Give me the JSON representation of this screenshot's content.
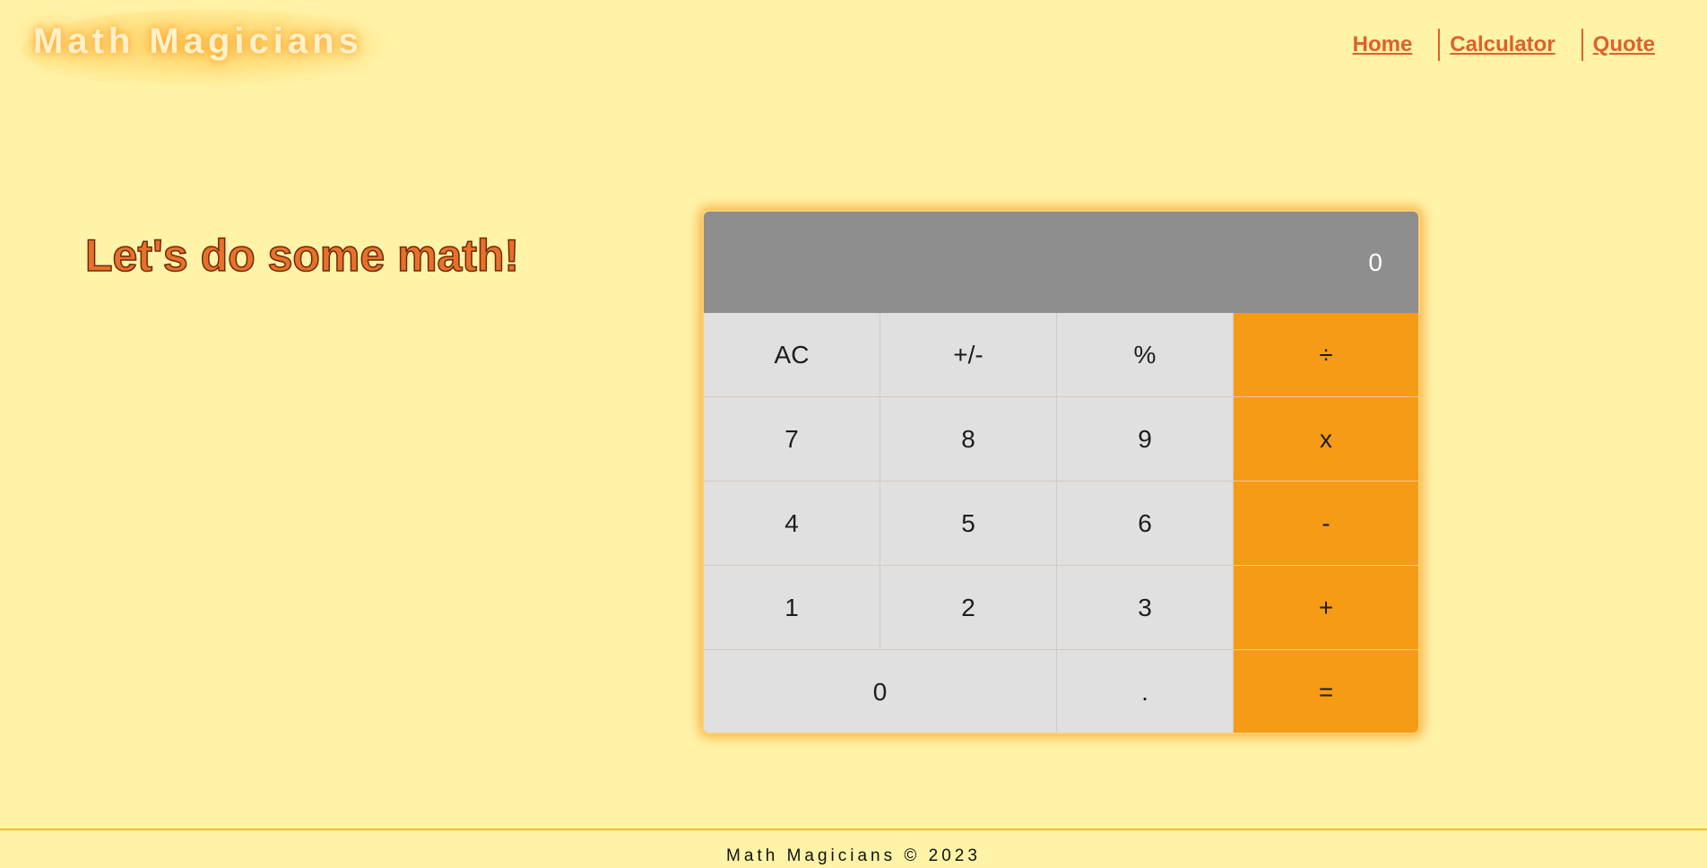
{
  "header": {
    "logo": "Math Magicians",
    "nav": [
      {
        "label": "Home"
      },
      {
        "label": "Calculator"
      },
      {
        "label": "Quote"
      }
    ]
  },
  "main": {
    "heading": "Let's do some math!"
  },
  "calculator": {
    "display": "0",
    "keys": [
      "AC",
      "+/-",
      "%",
      "÷",
      "7",
      "8",
      "9",
      "x",
      "4",
      "5",
      "6",
      "-",
      "1",
      "2",
      "3",
      "+",
      "0",
      ".",
      "="
    ]
  },
  "footer": {
    "text": "Math Magicians © 2023"
  },
  "colors": {
    "background": "#fff3a8",
    "accent": "#f59b16",
    "link": "#e0602a",
    "display": "#8f8e8e",
    "key": "#e0e0e0"
  }
}
